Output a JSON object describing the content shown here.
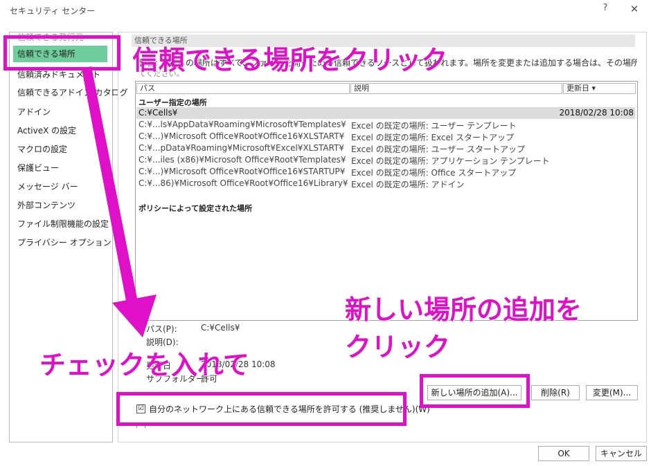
{
  "window": {
    "title": "セキュリティ センター",
    "help": "?",
    "close": "✕"
  },
  "sidebar": {
    "items": [
      {
        "label": "信頼できる発行元"
      },
      {
        "label": "信頼できる場所"
      },
      {
        "label": "信頼済みドキュメント"
      },
      {
        "label": "信頼できるアドイン カタログ"
      },
      {
        "label": "アドイン"
      },
      {
        "label": "ActiveX の設定"
      },
      {
        "label": "マクロの設定"
      },
      {
        "label": "保護ビュー"
      },
      {
        "label": "メッセージ バー"
      },
      {
        "label": "外部コンテンツ"
      },
      {
        "label": "ファイル制限機能の設定"
      },
      {
        "label": "プライバシー オプション"
      }
    ]
  },
  "main": {
    "section_title": "信頼できる場所",
    "description": "警告: これらの場所はすべて、ファイルを開くための信頼できるソースとして扱われます。場所を変更または追加する場合は、その場所が安全であることを確認し",
    "description2": "てください。",
    "columns": {
      "path": "パス",
      "description": "説明",
      "modified": "更新日 ▾"
    },
    "user_group": "ユーザー指定の場所",
    "policy_group": "ポリシーによって設定された場所",
    "rows": [
      {
        "path": "C:¥Cells¥",
        "desc": "",
        "date": "2018/02/28 10:08"
      },
      {
        "path": "C:¥...ls¥AppData¥Roaming¥Microsoft¥Templates¥",
        "desc": "Excel の既定の場所: ユーザー テンプレート",
        "date": ""
      },
      {
        "path": "C:¥...)¥Microsoft Office¥Root¥Office16¥XLSTART¥",
        "desc": "Excel の既定の場所: Excel スタートアップ",
        "date": ""
      },
      {
        "path": "C:¥...pData¥Roaming¥Microsoft¥Excel¥XLSTART¥",
        "desc": "Excel の既定の場所: ユーザー スタートアップ",
        "date": ""
      },
      {
        "path": "C:¥...iles (x86)¥Microsoft Office¥Root¥Templates¥",
        "desc": "Excel の既定の場所: アプリケーション テンプレート",
        "date": ""
      },
      {
        "path": "C:¥...)¥Microsoft Office¥Root¥Office16¥STARTUP¥",
        "desc": "Excel の既定の場所: Office スタートアップ",
        "date": ""
      },
      {
        "path": "C:¥...86)¥Microsoft Office¥Root¥Office16¥Library¥",
        "desc": "Excel の既定の場所: アドイン",
        "date": ""
      }
    ],
    "details": {
      "path_label": "パス(P):",
      "path_value": "C:¥Cells¥",
      "desc_label": "説明(D):",
      "modified_label": "更新日",
      "modified_value": "2018/02/28 10:08",
      "subfolder_label": "サブフォルダー:",
      "subfolder_value": "許可"
    }
  },
  "buttons": {
    "add": "新しい場所の追加(A)...",
    "remove": "削除(R)",
    "modify": "変更(M)...",
    "ok": "OK",
    "cancel": "キャンセル"
  },
  "checkboxes": {
    "network": {
      "label": "自分のネットワーク上にある信頼できる場所を許可する (推奨しません)(W)",
      "checked": "☑"
    }
  },
  "annotations": {
    "click_trusted": "信頼できる場所をクリック",
    "click_add_1": "新しい場所の追加を",
    "click_add_2": "クリック",
    "check_it": "チェックを入れて"
  },
  "colors": {
    "highlight": "#e010c8",
    "selected_sidebar": "#6fce9c",
    "selected_row": "#dcdcdc"
  }
}
